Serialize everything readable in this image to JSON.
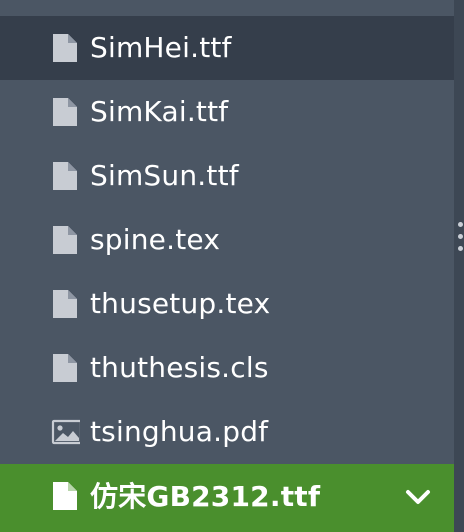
{
  "colors": {
    "panel_bg": "#4b5664",
    "hover_bg": "#353e4b",
    "selected_bg": "#4a8f2d",
    "text": "#ffffff",
    "icon": "#c8ccd3"
  },
  "file_tree": {
    "items": [
      {
        "label": "SimHei.ttf",
        "icon": "file-icon",
        "state": "hover"
      },
      {
        "label": "SimKai.ttf",
        "icon": "file-icon",
        "state": "normal"
      },
      {
        "label": "SimSun.ttf",
        "icon": "file-icon",
        "state": "normal"
      },
      {
        "label": "spine.tex",
        "icon": "file-icon",
        "state": "normal"
      },
      {
        "label": "thusetup.tex",
        "icon": "file-icon",
        "state": "normal"
      },
      {
        "label": "thuthesis.cls",
        "icon": "file-icon",
        "state": "normal"
      },
      {
        "label": "tsinghua.pdf",
        "icon": "image-file-icon",
        "state": "normal"
      },
      {
        "label": "仿宋GB2312.ttf",
        "icon": "file-icon",
        "state": "selected"
      }
    ],
    "selected_menu_icon": "chevron-down-icon"
  }
}
